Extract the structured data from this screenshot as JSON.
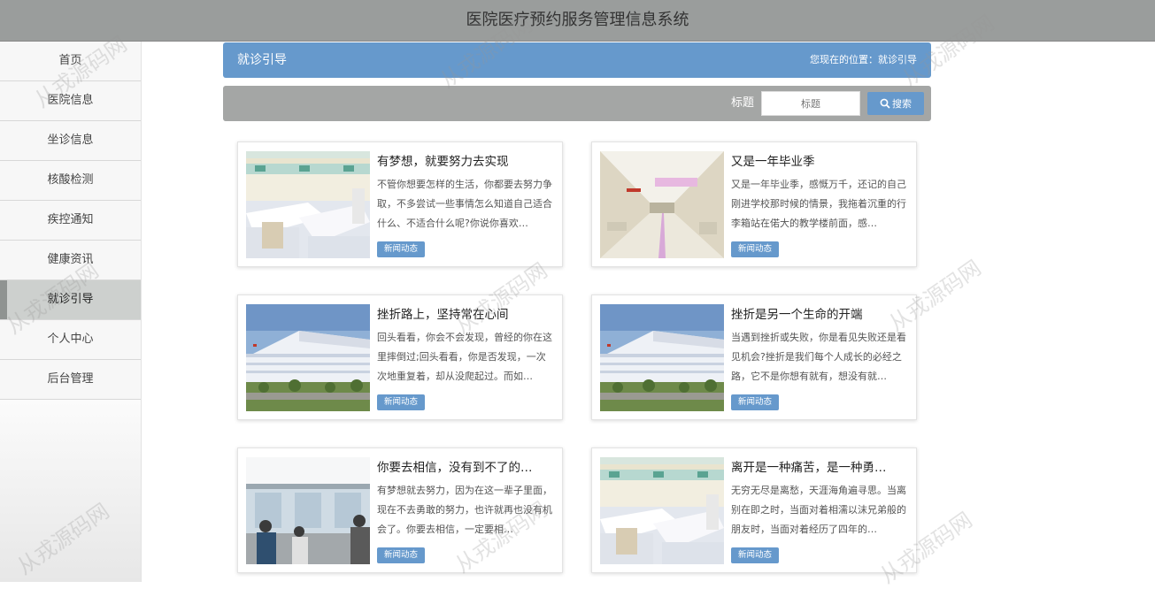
{
  "header": {
    "title": "医院医疗预约服务管理信息系统"
  },
  "sidebar": {
    "items": [
      {
        "label": "首页"
      },
      {
        "label": "医院信息"
      },
      {
        "label": "坐诊信息"
      },
      {
        "label": "核酸检测"
      },
      {
        "label": "疾控通知"
      },
      {
        "label": "健康资讯"
      },
      {
        "label": "就诊引导"
      },
      {
        "label": "个人中心"
      },
      {
        "label": "后台管理"
      }
    ],
    "active_index": 6
  },
  "breadcrumb": {
    "page": "就诊引导",
    "location": "您现在的位置：就诊引导"
  },
  "search": {
    "label": "标题",
    "placeholder": "标题",
    "button": "搜索"
  },
  "cards": [
    {
      "title": "有梦想，就要努力去实现",
      "excerpt": "不管你想要怎样的生活，你都要去努力争取，不多尝试一些事情怎么知道自己适合什么、不适合什么呢?你说你喜欢…",
      "tag": "新闻动态",
      "image": "hospital-ward"
    },
    {
      "title": "又是一年毕业季",
      "excerpt": "又是一年毕业季，感慨万千，还记的自己刚进学校那时候的情景，我拖着沉重的行李箱站在偌大的教学楼前面，感…",
      "tag": "新闻动态",
      "image": "hospital-corridor"
    },
    {
      "title": "挫折路上，坚持常在心间",
      "excerpt": "回头看看，你会不会发现，曾经的你在这里摔倒过;回头看看，你是否发现，一次次地重复着，却从没爬起过。而如…",
      "tag": "新闻动态",
      "image": "hospital-building"
    },
    {
      "title": "挫折是另一个生命的开端",
      "excerpt": "当遇到挫折或失败，你是看见失败还是看见机会?挫折是我们每个人成长的必经之路，它不是你想有就有，想没有就…",
      "tag": "新闻动态",
      "image": "hospital-building"
    },
    {
      "title": "你要去相信，没有到不了的…",
      "excerpt": "有梦想就去努力，因为在这一辈子里面，现在不去勇敢的努力，也许就再也没有机会了。你要去相信，一定要相…",
      "tag": "新闻动态",
      "image": "hospital-registration"
    },
    {
      "title": "离开是一种痛苦，是一种勇…",
      "excerpt": "无穷无尽是离愁，天涯海角遍寻思。当离别在即之时，当面对着相濡以沫兄弟般的朋友时，当面对着经历了四年的…",
      "tag": "新闻动态",
      "image": "hospital-ward"
    }
  ],
  "watermark": "从戎源码网",
  "colors": {
    "accent": "#6699cc",
    "header_bg": "#9a9d9c",
    "search_bg": "#a4a6a5"
  }
}
